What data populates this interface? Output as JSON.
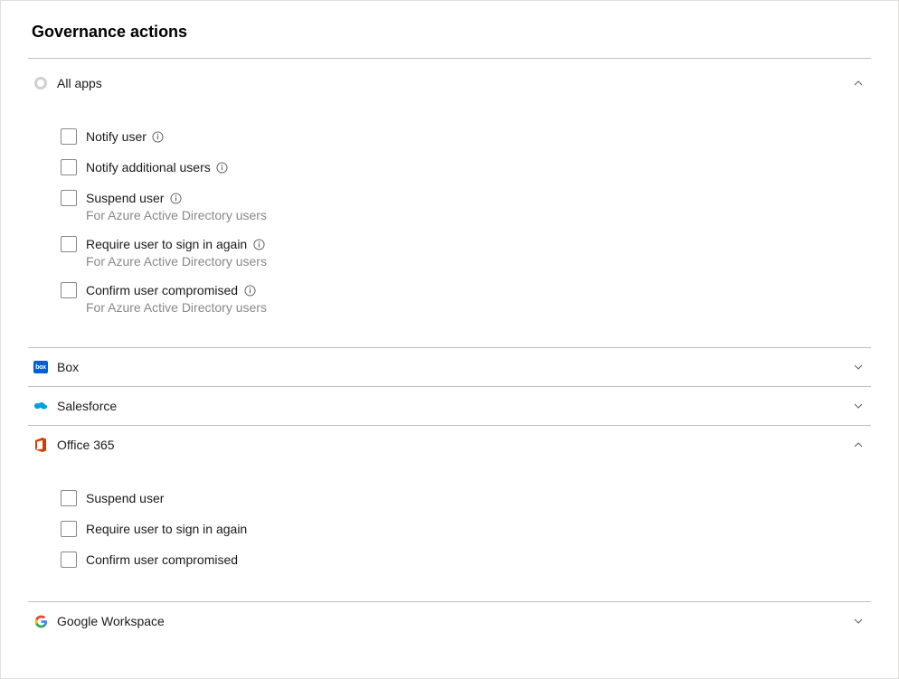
{
  "title": "Governance actions",
  "sections": [
    {
      "id": "all-apps",
      "label": "All apps",
      "icon": "ring",
      "expanded": true,
      "options": [
        {
          "label": "Notify user",
          "info": true
        },
        {
          "label": "Notify additional users",
          "info": true
        },
        {
          "label": "Suspend user",
          "info": true,
          "sub": "For Azure Active Directory users"
        },
        {
          "label": "Require user to sign in again",
          "info": true,
          "sub": "For Azure Active Directory users"
        },
        {
          "label": "Confirm user compromised",
          "info": true,
          "sub": "For Azure Active Directory users"
        }
      ]
    },
    {
      "id": "box",
      "label": "Box",
      "icon": "box",
      "expanded": false
    },
    {
      "id": "salesforce",
      "label": "Salesforce",
      "icon": "salesforce",
      "expanded": false
    },
    {
      "id": "office-365",
      "label": "Office 365",
      "icon": "office365",
      "expanded": true,
      "options": [
        {
          "label": "Suspend user"
        },
        {
          "label": "Require user to sign in again"
        },
        {
          "label": "Confirm user compromised"
        }
      ]
    },
    {
      "id": "google-workspace",
      "label": "Google Workspace",
      "icon": "google",
      "expanded": false
    }
  ]
}
